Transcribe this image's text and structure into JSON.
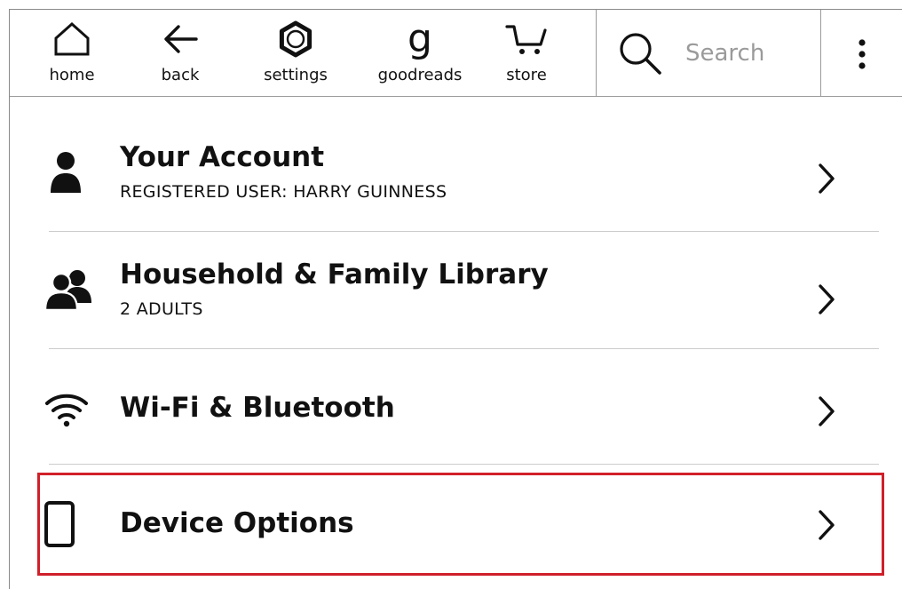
{
  "toolbar": {
    "home": {
      "label": "home",
      "icon": "home-icon"
    },
    "back": {
      "label": "back",
      "icon": "back-arrow-icon"
    },
    "settings": {
      "label": "settings",
      "icon": "gear-icon"
    },
    "goodreads": {
      "label": "goodreads",
      "glyph": "g",
      "icon": "goodreads-g-icon"
    },
    "store": {
      "label": "store",
      "icon": "cart-icon"
    }
  },
  "search": {
    "placeholder": "Search",
    "icon": "search-icon"
  },
  "menu": {
    "icon": "more-vertical-icon"
  },
  "settings_list": [
    {
      "title": "Your Account",
      "subtitle": "REGISTERED USER: HARRY GUINNESS",
      "icon": "person-icon"
    },
    {
      "title": "Household & Family Library",
      "subtitle": "2 ADULTS",
      "icon": "people-icon"
    },
    {
      "title": "Wi-Fi & Bluetooth",
      "subtitle": "",
      "icon": "wifi-icon"
    },
    {
      "title": "Device Options",
      "subtitle": "",
      "icon": "device-icon"
    }
  ],
  "colors": {
    "text": "#111111",
    "placeholder": "#9a9a9a",
    "divider": "#cccccc",
    "highlight": "#d0202a"
  }
}
